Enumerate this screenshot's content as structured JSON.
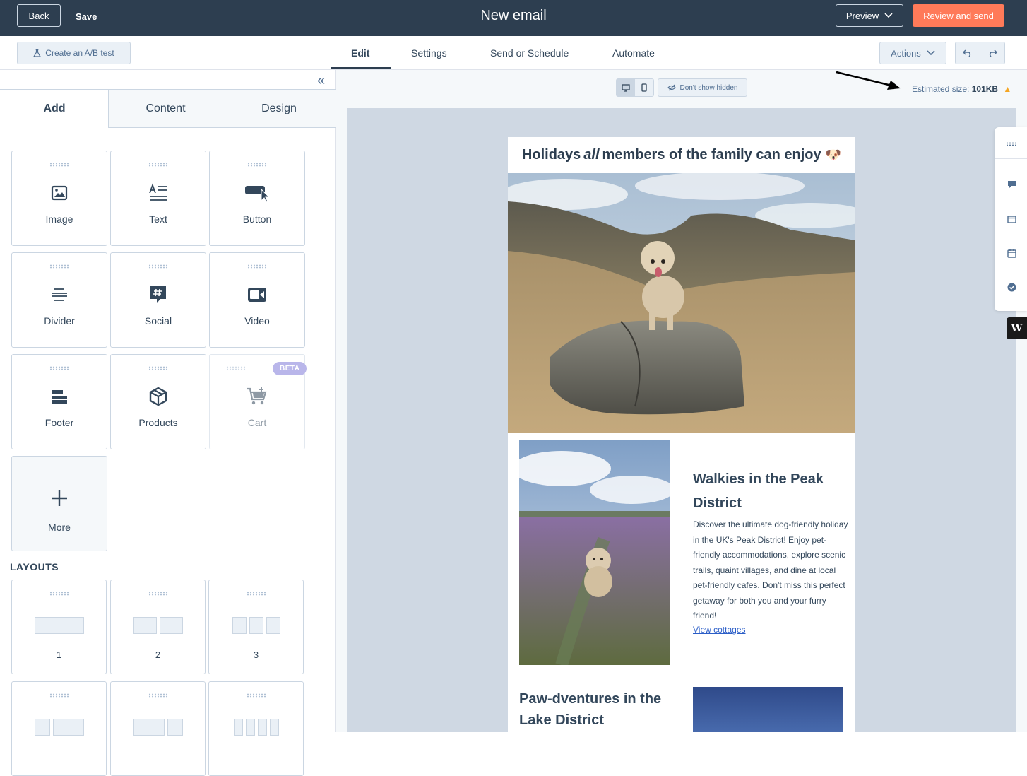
{
  "topbar": {
    "back_label": "Back",
    "save_label": "Save",
    "title": "New email",
    "preview_label": "Preview",
    "review_label": "Review and send",
    "review_color": "#ff7a59",
    "bar_color": "#2d3e50"
  },
  "subbar": {
    "ab_test_label": "Create an A/B test",
    "tabs": [
      {
        "label": "Edit",
        "active": true
      },
      {
        "label": "Settings",
        "active": false
      },
      {
        "label": "Send or Schedule",
        "active": false
      },
      {
        "label": "Automate",
        "active": false
      }
    ],
    "actions_label": "Actions"
  },
  "panel": {
    "tabs": [
      {
        "label": "Add",
        "active": true
      },
      {
        "label": "Content",
        "active": false
      },
      {
        "label": "Design",
        "active": false
      }
    ],
    "modules": [
      {
        "label": "Image",
        "icon": "image-icon"
      },
      {
        "label": "Text",
        "icon": "text-icon"
      },
      {
        "label": "Button",
        "icon": "button-icon"
      },
      {
        "label": "Divider",
        "icon": "divider-icon"
      },
      {
        "label": "Social",
        "icon": "social-icon"
      },
      {
        "label": "Video",
        "icon": "video-icon"
      },
      {
        "label": "Footer",
        "icon": "footer-icon"
      },
      {
        "label": "Products",
        "icon": "products-icon"
      },
      {
        "label": "Cart",
        "icon": "cart-icon",
        "badge": "BETA",
        "disabled": true
      },
      {
        "label": "More",
        "icon": "plus-icon"
      }
    ],
    "layouts_heading": "LAYOUTS",
    "layouts": [
      {
        "label": "1"
      },
      {
        "label": "2"
      },
      {
        "label": "3"
      }
    ]
  },
  "canvas": {
    "hidden_toggle_label": "Don't show hidden",
    "estimated_size_label": "Estimated size:",
    "estimated_size_value": "101KB"
  },
  "email": {
    "headline_before": "Holidays",
    "headline_italic": "all",
    "headline_after": "members of the family can enjoy",
    "headline_emoji": "🐶",
    "article1_title": "Walkies in the Peak District",
    "article1_body": "Discover the ultimate dog-friendly holiday in the UK's Peak District! Enjoy pet-friendly accommodations, explore scenic trails, quaint villages, and dine at local pet-friendly cafes. Don't miss this perfect getaway for both you and your furry friend!",
    "article1_link": "View cottages",
    "article2_title": "Paw-dventures in the Lake District"
  }
}
